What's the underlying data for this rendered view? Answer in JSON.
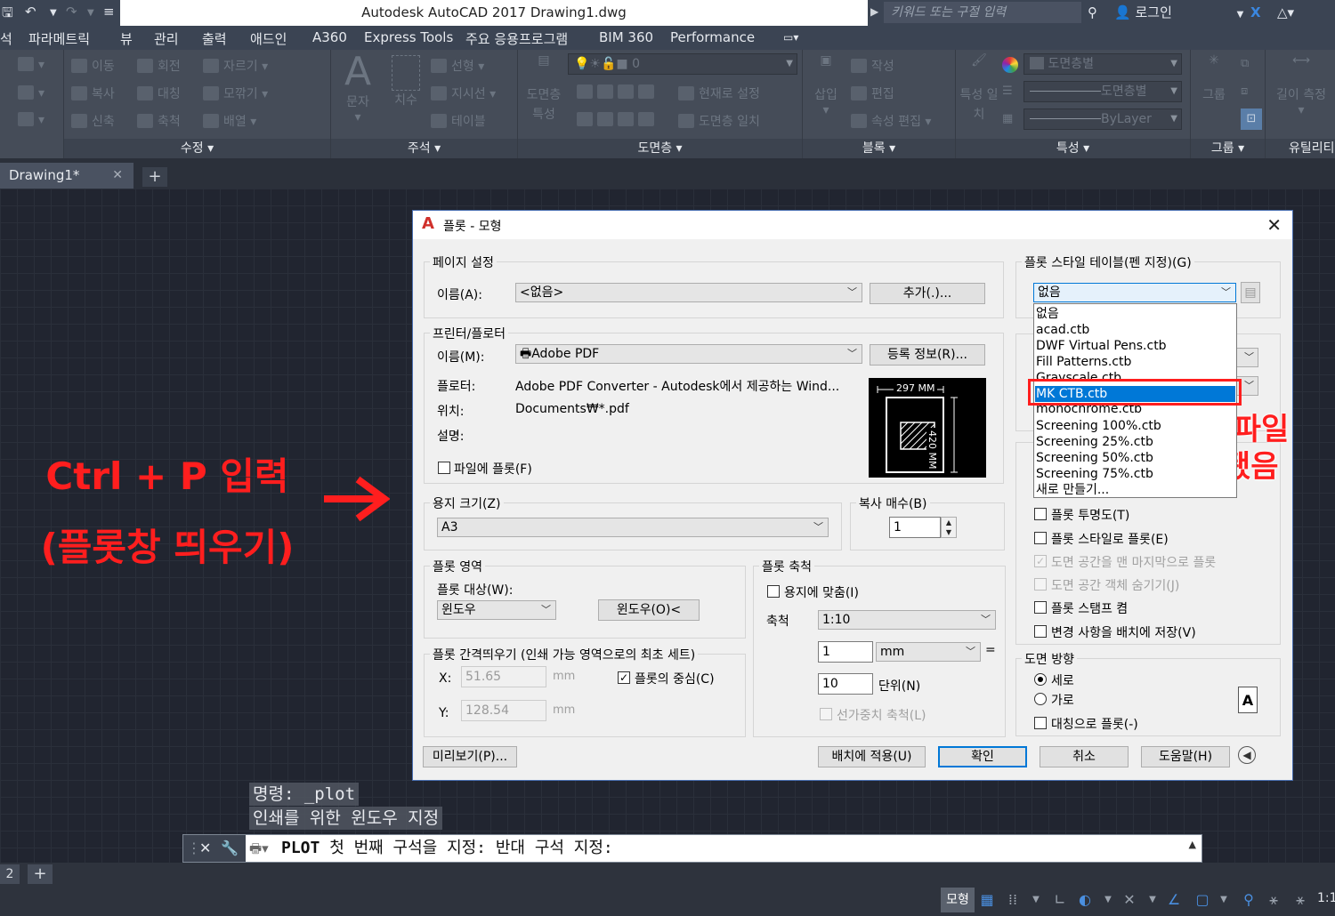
{
  "app": {
    "title": "Autodesk AutoCAD 2017     Drawing1.dwg",
    "search_placeholder": "키워드 또는 구절 입력",
    "login_label": "로그인"
  },
  "menu": {
    "items": [
      "파라메트릭",
      "뷰",
      "관리",
      "출력",
      "애드인",
      "A360",
      "Express Tools",
      "주요 응용프로그램",
      "BIM 360",
      "Performance"
    ]
  },
  "ribbon": {
    "modify": {
      "title": "수정",
      "tools": [
        "이동",
        "회전",
        "자르기",
        "복사",
        "대칭",
        "모깎기",
        "신축",
        "축척",
        "배열"
      ]
    },
    "annotation": {
      "title": "주석",
      "big_tools": [
        "문자",
        "치수"
      ],
      "tools": [
        "선형",
        "지시선",
        "테이블"
      ]
    },
    "layers": {
      "title": "도면층",
      "big_tool": "도면층 특성",
      "layer_combo": "0",
      "tools": [
        "현재로 설정",
        "도면층 일치"
      ]
    },
    "block": {
      "title": "블록",
      "big_tool": "삽입",
      "tools": [
        "작성",
        "편집",
        "속성 편집"
      ]
    },
    "properties": {
      "title": "특성",
      "big_tool": "특성 일치",
      "color_combo": "도면층별",
      "linetype_combo": "도면층별",
      "lineweight_combo": "ByLayer"
    },
    "groups": {
      "title": "그룹",
      "big_tool": "그룹"
    },
    "utilities": {
      "title": "유틸리티",
      "big_tool": "길이 측정"
    }
  },
  "file_tabs": {
    "active": "Drawing1*"
  },
  "annotations": {
    "left_line1": "Ctrl + P 입력",
    "left_line2": "(플롯창 띄우기)",
    "right_line1": "CTB 파일",
    "right_line2": "추가됐음"
  },
  "command": {
    "history": [
      "명령: _plot",
      "인쇄를 위한 윈도우 지정"
    ],
    "prompt_cmd": "PLOT",
    "prompt_text": " 첫 번째 구석을 지정: 반대 구석 지정:"
  },
  "layout_tab_label": "2",
  "status": {
    "model": "모형",
    "scale": "1:1"
  },
  "dialog": {
    "title": "플롯 - 모형",
    "page_setup": {
      "group": "페이지 설정",
      "name_label": "이름(A):",
      "name_value": "<없음>",
      "add_button": "추가(.)..."
    },
    "printer": {
      "group": "프린터/플로터",
      "name_label": "이름(M):",
      "name_value": "Adobe PDF",
      "properties_button": "등록 정보(R)...",
      "plotter_label": "플로터:",
      "plotter_value": "Adobe PDF Converter - Autodesk에서 제공하는 Wind...",
      "where_label": "위치:",
      "where_value": "Documents₩*.pdf",
      "desc_label": "설명:",
      "plot_to_file": "파일에 플롯(F)",
      "preview_width": "297 MM",
      "preview_height": "420 MM"
    },
    "paper_size": {
      "group": "용지 크기(Z)",
      "value": "A3"
    },
    "copies": {
      "group": "복사 매수(B)",
      "value": "1"
    },
    "plot_area": {
      "group": "플롯 영역",
      "what_label": "플롯 대상(W):",
      "what_value": "윈도우",
      "window_button": "윈도우(O)<"
    },
    "plot_offset": {
      "group": "플롯 간격띄우기 (인쇄 가능 영역으로의 최초 세트)",
      "x_label": "X:",
      "x_value": "51.65",
      "y_label": "Y:",
      "y_value": "128.54",
      "unit": "mm",
      "center_label": "플롯의 중심(C)",
      "center_checked": true
    },
    "plot_scale": {
      "group": "플롯 축척",
      "fit_label": "용지에 맞춤(I)",
      "fit_checked": false,
      "scale_label": "축척",
      "scale_value": "1:10",
      "value1": "1",
      "unit_value": "mm",
      "equals": "=",
      "value2": "10",
      "units_label": "단위(N)",
      "lineweights_label": "선가중치 축척(L)"
    },
    "style_table": {
      "group": "플롯 스타일 테이블(펜 지정)(G)",
      "value": "없음",
      "options": [
        "없음",
        "acad.ctb",
        "DWF Virtual Pens.ctb",
        "Fill Patterns.ctb",
        "Grayscale.ctb",
        "MK CTB.ctb",
        "monochrome.ctb",
        "Screening 100%.ctb",
        "Screening 25%.ctb",
        "Screening 50%.ctb",
        "Screening 75%.ctb",
        "새로 만들기..."
      ],
      "selected_index": 5
    },
    "plot_options": {
      "transparency": "플롯 투명도(T)",
      "with_styles": "플롯 스타일로 플롯(E)",
      "paperspace_last": "도면 공간을 맨 마지막으로 플롯",
      "hide_paperspace": "도면 공간 객체 숨기기(J)",
      "stamp_on": "플롯 스탬프 켬",
      "save_changes": "변경 사항을 배치에 저장(V)"
    },
    "orientation": {
      "group": "도면 방향",
      "portrait": "세로",
      "landscape": "가로",
      "upside_down": "대칭으로 플롯(-)",
      "icon_letter": "A"
    },
    "buttons": {
      "preview": "미리보기(P)...",
      "apply": "배치에 적용(U)",
      "ok": "확인",
      "cancel": "취소",
      "help": "도움말(H)"
    }
  }
}
